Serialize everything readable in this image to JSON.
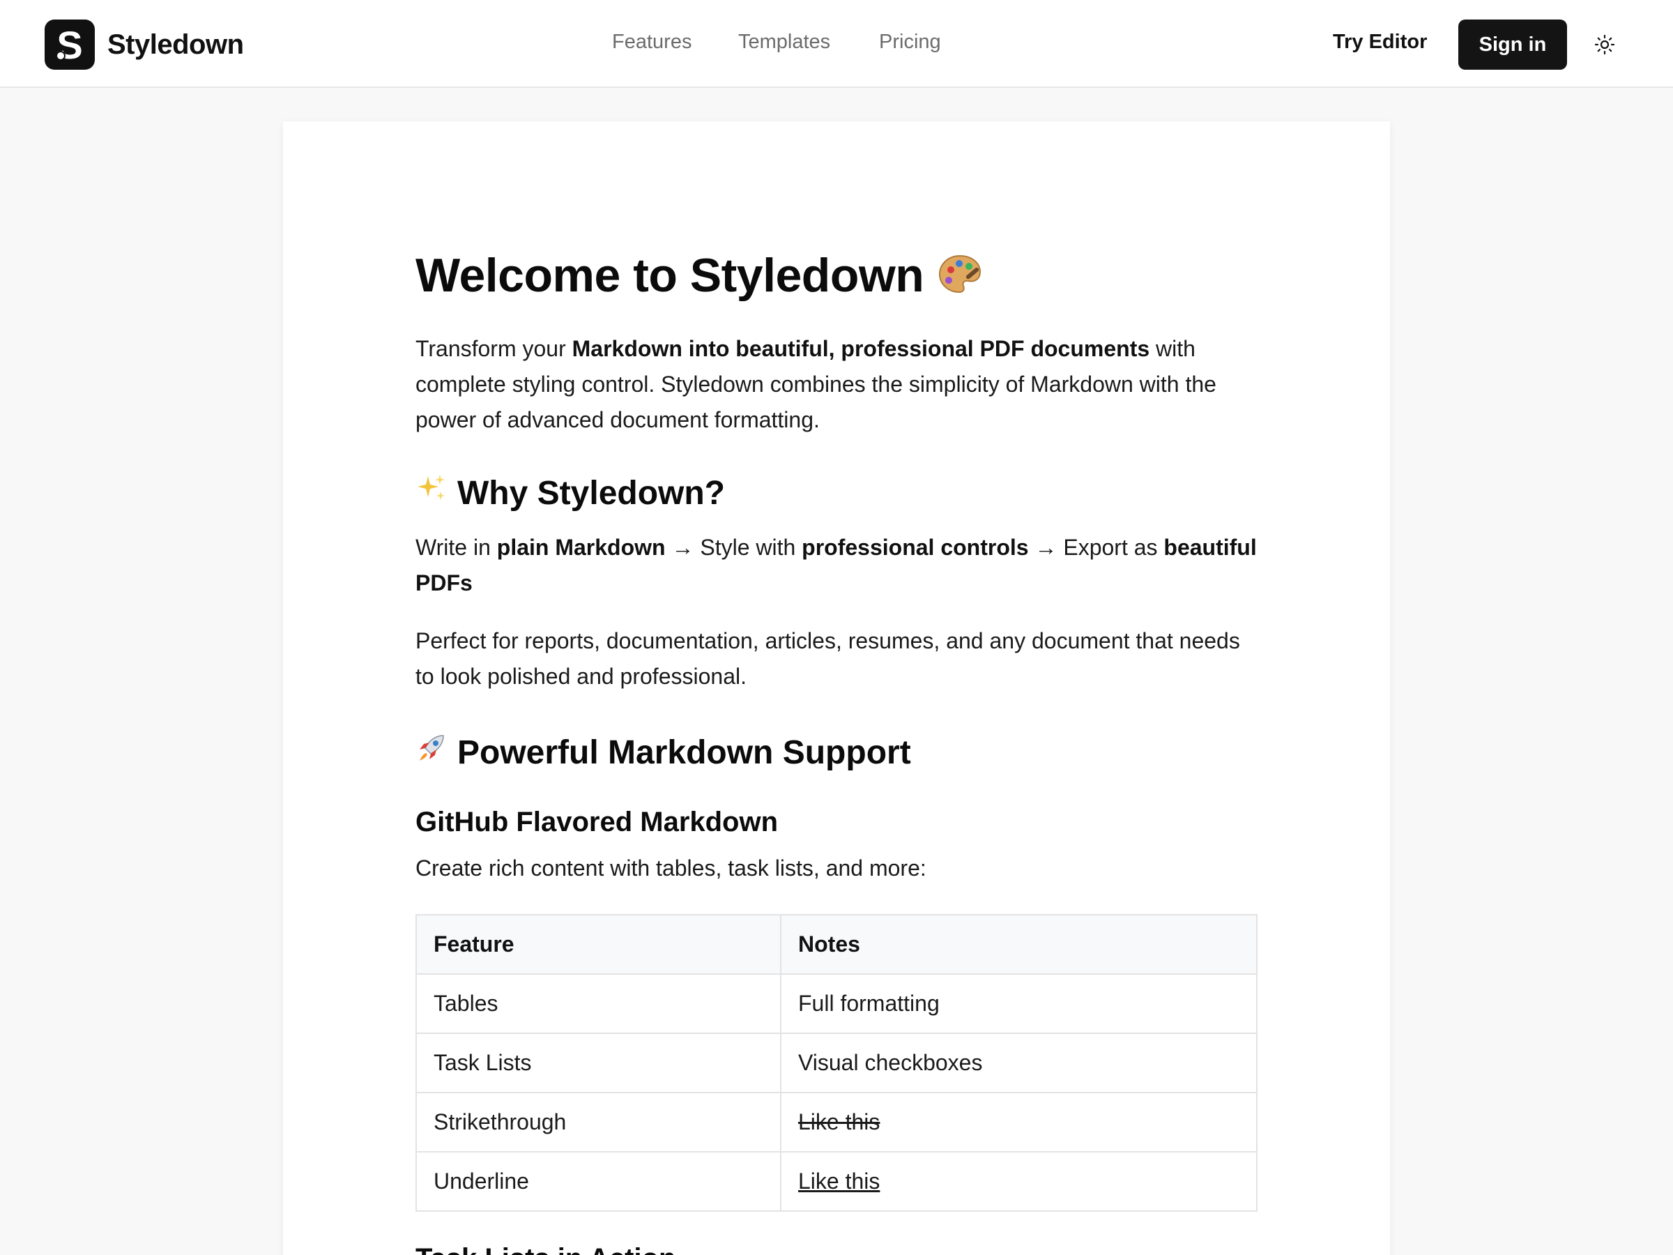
{
  "header": {
    "brand_name": "Styledown",
    "logo_letter": "S",
    "nav": [
      "Features",
      "Templates",
      "Pricing"
    ],
    "try_editor": "Try Editor",
    "sign_in": "Sign in",
    "theme_icon": "sun-icon"
  },
  "doc": {
    "title": "Welcome to Styledown",
    "title_emoji": "palette",
    "intro": {
      "pre": "Transform your ",
      "bold": "Markdown into beautiful, professional PDF documents",
      "post": " with complete styling control. Styledown combines the simplicity of Markdown with the power of advanced document formatting."
    },
    "why": {
      "emoji": "sparkles",
      "title": "Why Styledown?",
      "flow": {
        "t1": "Write in ",
        "b1": "plain Markdown",
        "t2": " → Style with ",
        "b2": "professional controls",
        "t3": " → Export as ",
        "b3": "beautiful PDFs"
      },
      "perfect": "Perfect for reports, documentation, articles, resumes, and any document that needs to look polished and professional."
    },
    "power": {
      "emoji": "rocket",
      "title": "Powerful Markdown Support",
      "gfm_title": "GitHub Flavored Markdown",
      "gfm_text": "Create rich content with tables, task lists, and more:",
      "table": {
        "headers": [
          "Feature",
          "Notes"
        ],
        "rows": [
          [
            "Tables",
            "Full formatting"
          ],
          [
            "Task Lists",
            "Visual checkboxes"
          ],
          [
            "Strikethrough",
            "Like this"
          ],
          [
            "Underline",
            "Like this"
          ]
        ]
      },
      "next_title": "Task Lists in Action"
    }
  },
  "colors": {
    "background": "#f8f8f8",
    "card": "#ffffff",
    "text": "#111111",
    "nav_muted": "#6b6b6b",
    "button_dark": "#141414",
    "border": "#e3e3e3",
    "table_header_bg": "#f8f9fb"
  }
}
